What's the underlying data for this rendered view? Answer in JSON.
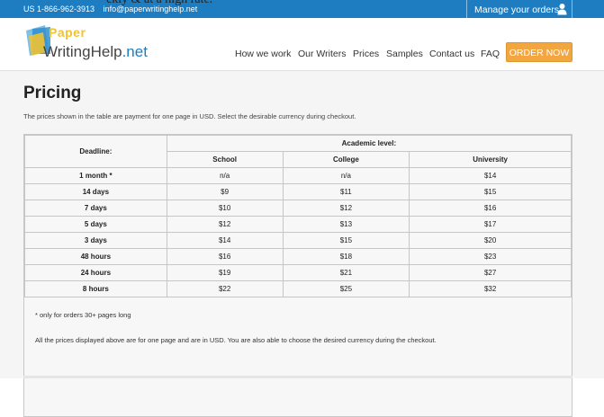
{
  "overflow_text": "ckly & at a high rate.",
  "topbar": {
    "phone": "US 1-866-962-3913",
    "email": "info@paperwritinghelp.net",
    "manage_orders": "Manage your orders"
  },
  "logo": {
    "paper_word": "Paper",
    "brand_main": "WritingHelp",
    "brand_tld": ".net"
  },
  "nav": {
    "items": [
      "How we work",
      "Our Writers",
      "Prices",
      "Samples",
      "Contact us",
      "FAQ"
    ],
    "order_button": "ORDER NOW"
  },
  "main": {
    "title": "Pricing",
    "intro": "The prices shown in the table are payment for one page in USD. Select the desirable currency during checkout."
  },
  "table": {
    "deadline_header": "Deadline:",
    "level_header": "Academic level:",
    "levels": [
      "School",
      "College",
      "University"
    ],
    "rows": [
      {
        "deadline": "1 month *",
        "prices": [
          "n/a",
          "n/a",
          "$14"
        ]
      },
      {
        "deadline": "14 days",
        "prices": [
          "$9",
          "$11",
          "$15"
        ]
      },
      {
        "deadline": "7 days",
        "prices": [
          "$10",
          "$12",
          "$16"
        ]
      },
      {
        "deadline": "5 days",
        "prices": [
          "$12",
          "$13",
          "$17"
        ]
      },
      {
        "deadline": "3 days",
        "prices": [
          "$14",
          "$15",
          "$20"
        ]
      },
      {
        "deadline": "48 hours",
        "prices": [
          "$16",
          "$18",
          "$23"
        ]
      },
      {
        "deadline": "24 hours",
        "prices": [
          "$19",
          "$21",
          "$27"
        ]
      },
      {
        "deadline": "8 hours",
        "prices": [
          "$22",
          "$25",
          "$32"
        ]
      }
    ]
  },
  "notes": {
    "footnote": "* only for orders 30+ pages long",
    "summary": "All the prices displayed above are for one page and are in USD. You are also able to choose the desired currency during the checkout."
  },
  "colors": {
    "topbar": "#1e7dc0",
    "accent": "#f1a640",
    "logo_yellow": "#f1c232"
  }
}
